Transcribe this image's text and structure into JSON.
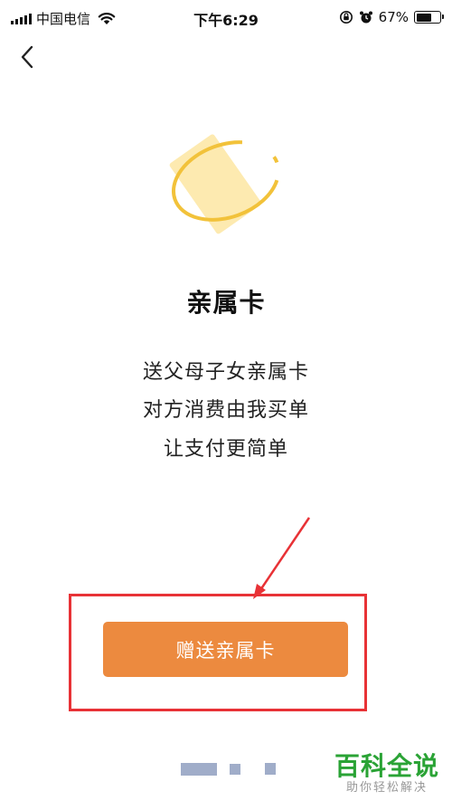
{
  "status_bar": {
    "carrier": "中国电信",
    "time": "下午6:29",
    "battery_percent": "67%",
    "battery_level": 0.67
  },
  "card": {
    "title": "亲属卡",
    "lines": [
      "送父母子女亲属卡",
      "对方消费由我买单",
      "让支付更简单"
    ]
  },
  "action": {
    "gift_label": "赠送亲属卡"
  },
  "watermark": {
    "main": "百科全说",
    "sub": "助你轻松解决"
  },
  "colors": {
    "button": "#ec8a3f",
    "highlight": "#e83236",
    "card_fill": "#fdeab0",
    "ring": "#f2c23a",
    "watermark_green": "#2aa335"
  }
}
